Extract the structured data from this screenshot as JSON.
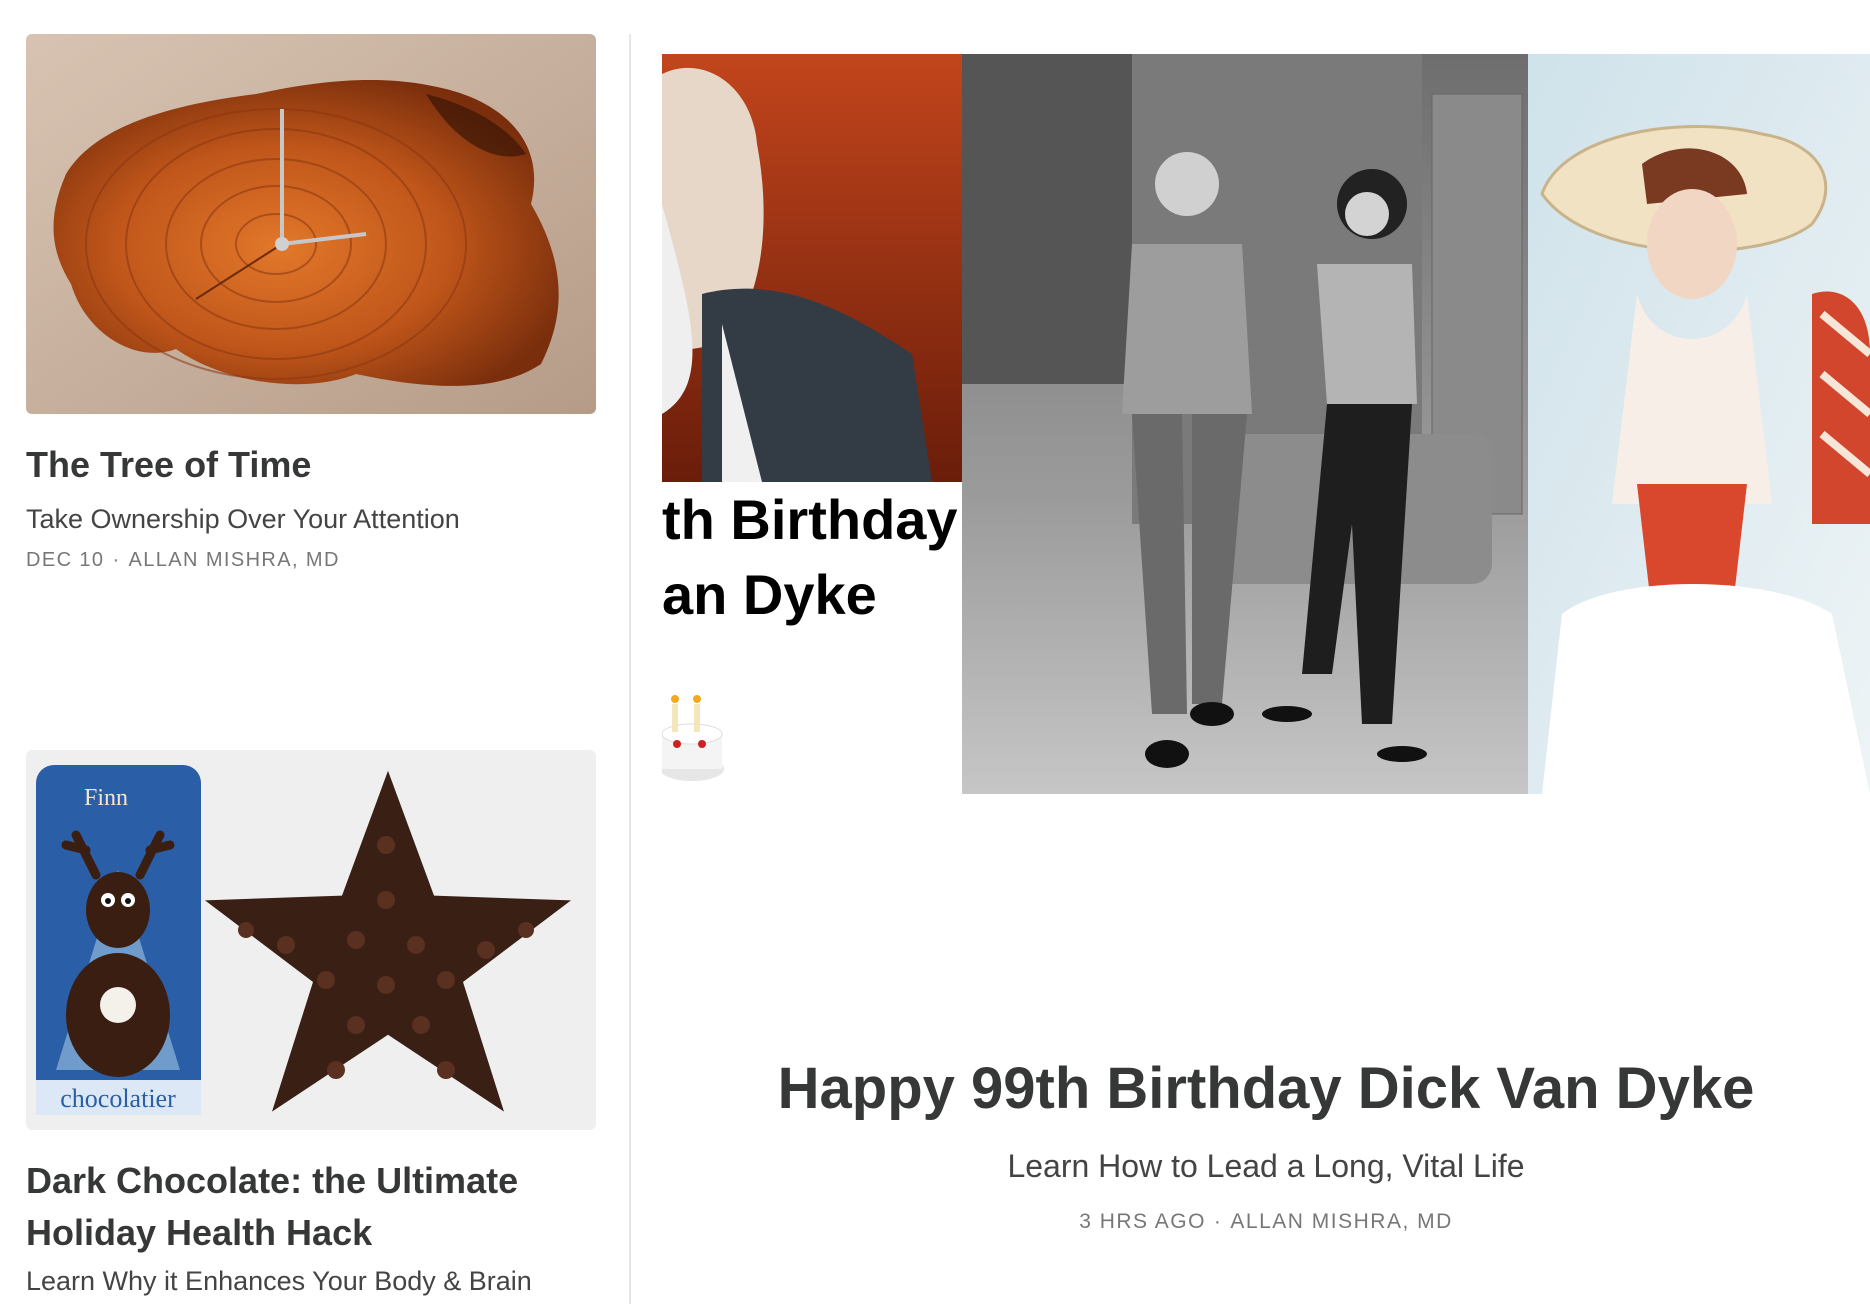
{
  "posts": [
    {
      "title": "The Tree of Time",
      "subtitle": "Take Ownership Over Your Attention",
      "date": "DEC 10",
      "author": "ALLAN MISHRA, MD",
      "image_icon": "wood-clock-image"
    },
    {
      "title": "Dark Chocolate: the Ultimate Holiday Health Hack",
      "subtitle": "Learn Why it Enhances Your Body & Brain",
      "image_icon": "chocolate-image",
      "image_text": {
        "brand": "Finn",
        "label": "chocolatier"
      }
    }
  ],
  "feature": {
    "title": "Happy 99th Birthday Dick Van Dyke",
    "subtitle": "Learn How to Lead a Long, Vital Life",
    "date": "3 HRS AGO",
    "author": "ALLAN MISHRA, MD",
    "image_icon": "collage-image",
    "image_text": {
      "line1": "th Birthday",
      "line2": "an Dyke"
    }
  },
  "meta_separator": "·",
  "colors": {
    "text": "#363737",
    "meta": "#777777",
    "divider": "#e6e6e6"
  }
}
